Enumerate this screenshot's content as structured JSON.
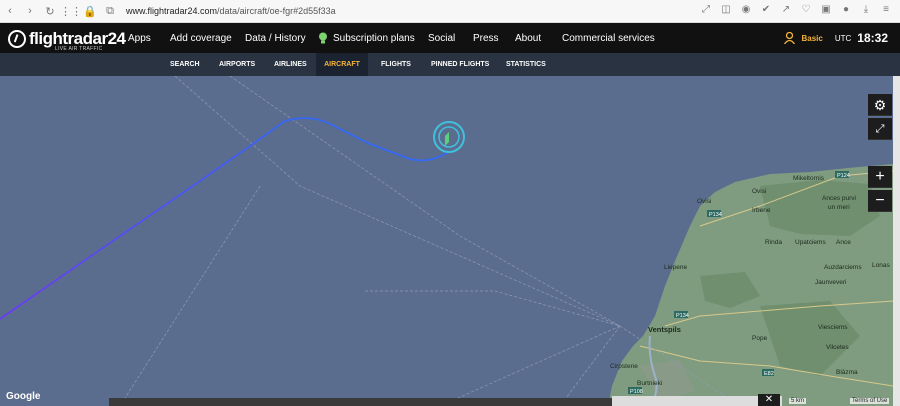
{
  "browser": {
    "url_host": "www.flightradar24.com",
    "url_path": "/data/aircraft/oe-fgr#2d55f33a"
  },
  "brand": {
    "name_text": "flightradar",
    "name_num": "24",
    "tagline": "LIVE AIR TRAFFIC"
  },
  "topnav": {
    "apps": "Apps",
    "add_coverage": "Add coverage",
    "data_history": "Data / History",
    "subscription_plans": "Subscription plans",
    "social": "Social",
    "press": "Press",
    "about": "About",
    "commercial_services": "Commercial services"
  },
  "account": {
    "plan": "Basic",
    "tz": "UTC",
    "time": "18:32"
  },
  "subnav": {
    "search": "SEARCH",
    "airports": "AIRPORTS",
    "airlines": "AIRLINES",
    "aircraft": "AIRCRAFT",
    "flights": "FLIGHTS",
    "pinned_flights": "PINNED FLIGHTS",
    "statistics": "STATISTICS"
  },
  "map": {
    "places": {
      "mikeltornis": "Mikeltornis",
      "ovisi": "Ovisi",
      "ances_purvi": "Ances purvi",
      "un_meri": "un meri",
      "irbene": "Irbene",
      "rinda": "Rinda",
      "upatciems": "Upatciems",
      "ance": "Ance",
      "liepene": "Liepene",
      "auzdarciems": "Auzdarciems",
      "lonas": "Lonas",
      "jaunveveri": "Jaunveveri",
      "ventspils": "Ventspils",
      "viesciems": "Viesciems",
      "pope": "Pope",
      "vilcetes": "Vilcetes",
      "cirpstene": "Cirpstene",
      "burtnieki": "Burtnieki",
      "blazma": "Blāzma"
    },
    "roads": {
      "p124": "P124",
      "p134": "P134",
      "p134b": "P134",
      "p108": "P108",
      "e82": "E82"
    },
    "scale_label": "5 km",
    "terms_label": "Terms of Use",
    "google_label": "Google"
  },
  "colors": {
    "sea": "#5b6d8e",
    "land": "#7a9a7e",
    "track": "#2d6df5",
    "accent": "#f4b43a"
  }
}
